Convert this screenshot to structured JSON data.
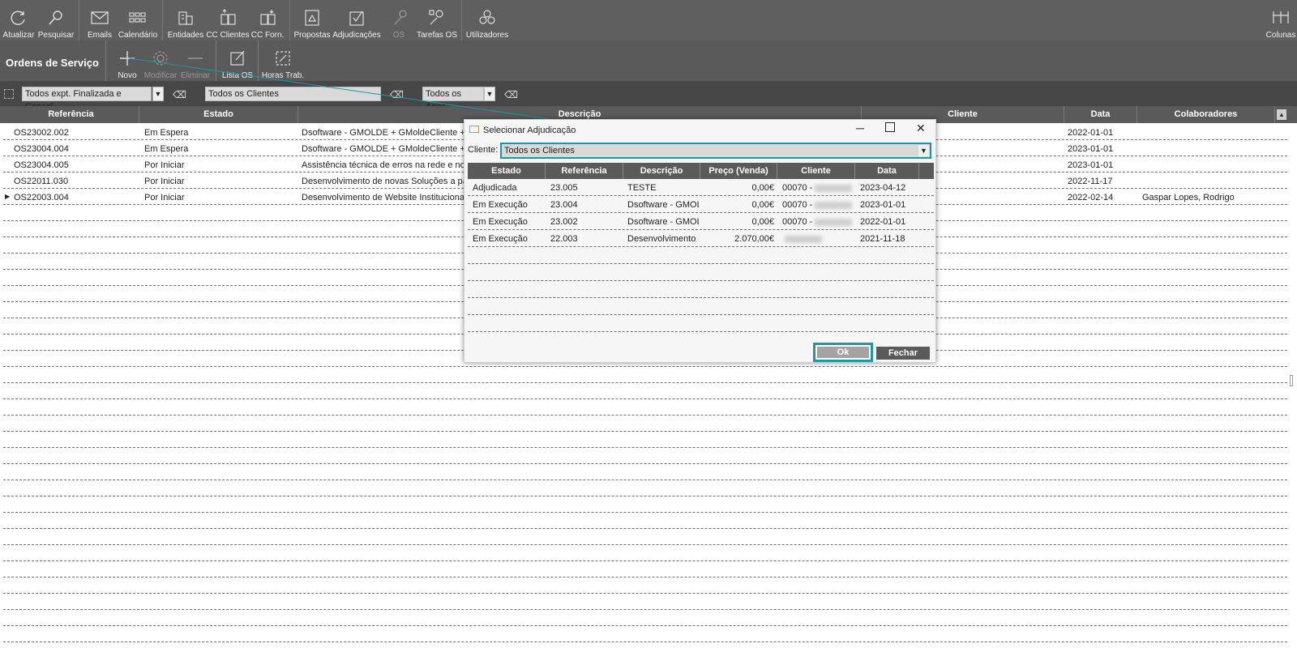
{
  "toolbar": {
    "atualizar": "Atualizar",
    "pesquisar": "Pesquisar",
    "emails": "Emails",
    "calendario": "Calendário",
    "entidades": "Entidades",
    "cc_clientes": "CC Clientes",
    "cc_forn": "CC Forn.",
    "propostas": "Propostas",
    "adjudicacoes": "Adjudicações",
    "os": "OS",
    "tarefas_os": "Tarefas OS",
    "utilizadores": "Utilizadores",
    "colunas": "Colunas"
  },
  "module": {
    "title": "Ordens de Serviço",
    "novo": "Novo",
    "modificar": "Modificar",
    "eliminar": "Eliminar",
    "lista_os": "Lista OS",
    "horas_trab": "Horas Trab."
  },
  "filters": {
    "estado": "Todos expt. Finalizada e Cancel.",
    "clientes": "Todos os Clientes",
    "anos": "Todos os Anos"
  },
  "grid": {
    "columns": [
      "Referência",
      "Estado",
      "Descrição",
      "Cliente",
      "Data",
      "Colaboradores"
    ],
    "rows": [
      {
        "ref": "OS23002.002",
        "estado": "Em Espera",
        "descricao": "Dsoftware - GMOLDE + GMoldeCliente + SV",
        "data": "2022-01-01",
        "colab": ""
      },
      {
        "ref": "OS23004.004",
        "estado": "Em Espera",
        "descricao": "Dsoftware - GMOLDE + GMoldeCliente + SV",
        "data": "2023-01-01",
        "colab": ""
      },
      {
        "ref": "OS23004.005",
        "estado": "Por Iniciar",
        "descricao": "Assistência técnica de erros na rede e no so",
        "data": "2023-01-01",
        "colab": ""
      },
      {
        "ref": "OS22011.030",
        "estado": "Por Iniciar",
        "descricao": "Desenvolvimento de novas Soluções a part",
        "data": "2022-11-17",
        "colab": ""
      },
      {
        "ref": "OS22003.004",
        "estado": "Por Iniciar",
        "descricao": "Desenvolvimento de Website Institucional +",
        "data": "2022-02-14",
        "colab": "Gaspar Lopes, Rodrigo"
      }
    ]
  },
  "dialog": {
    "title": "Selecionar Adjudicação",
    "cliente_label": "Cliente:",
    "cliente_value": "Todos os Clientes",
    "columns": [
      "Estado",
      "Referência",
      "Descrição",
      "Preço (Venda)",
      "Cliente",
      "Data"
    ],
    "rows": [
      {
        "estado": "Adjudicada",
        "ref": "23.005",
        "descricao": "TESTE",
        "preco": "0,00€",
        "cliente": "00070 -",
        "data": "2023-04-12"
      },
      {
        "estado": "Em Execução",
        "ref": "23.004",
        "descricao": "Dsoftware - GMOLD",
        "preco": "0,00€",
        "cliente": "00070 -",
        "data": "2023-01-01"
      },
      {
        "estado": "Em Execução",
        "ref": "23.002",
        "descricao": "Dsoftware - GMOLD",
        "preco": "0,00€",
        "cliente": "00070 -",
        "data": "2022-01-01"
      },
      {
        "estado": "Em Execução",
        "ref": "22.003",
        "descricao": "Desenvolvimento d",
        "preco": "2.070,00€",
        "cliente": "",
        "data": "2021-11-18"
      }
    ],
    "ok": "Ok",
    "fechar": "Fechar"
  },
  "colors": {
    "accent": "#1d97a6",
    "toolbar": "#5f5f5f",
    "header": "#5a5a5a"
  }
}
